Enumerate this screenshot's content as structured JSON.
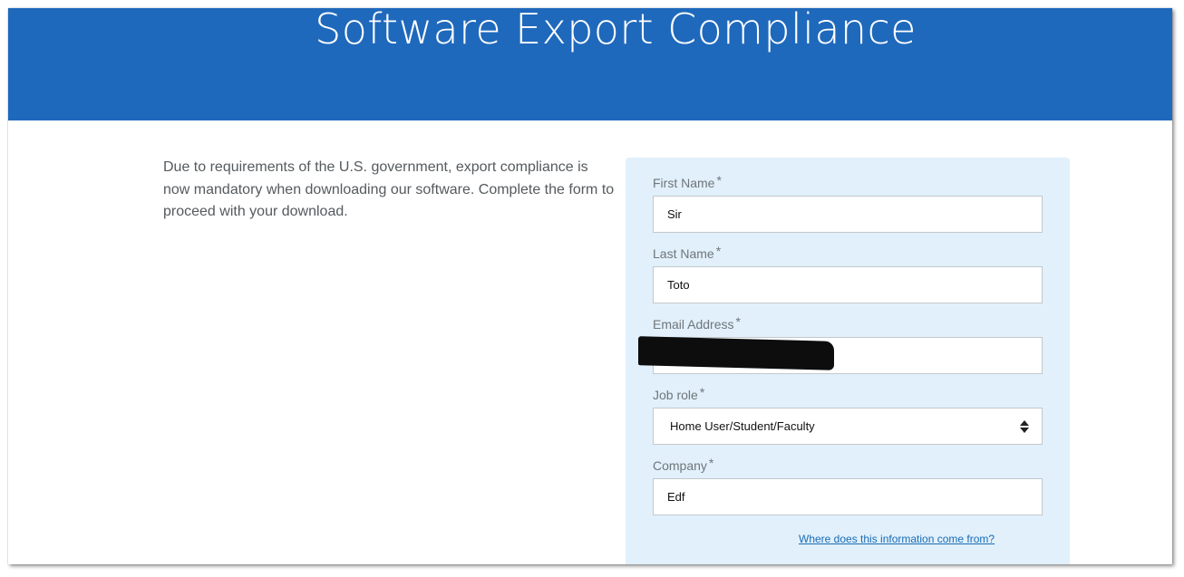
{
  "header": {
    "title": "Software Export Compliance"
  },
  "intro": {
    "text": "Due to requirements of the U.S. government, export compliance is now mandatory when downloading our software. Complete the form to proceed with your download."
  },
  "form": {
    "required_mark": "*",
    "first_name": {
      "label": "First Name",
      "value": "Sir"
    },
    "last_name": {
      "label": "Last Name",
      "value": "Toto"
    },
    "email": {
      "label": "Email Address",
      "value": "",
      "redacted": true
    },
    "job_role": {
      "label": "Job role",
      "selected": "Home User/Student/Faculty",
      "icon": "select-arrows-icon"
    },
    "company": {
      "label": "Company",
      "value": "Edf"
    },
    "help_link": "Where does this information come from?"
  },
  "colors": {
    "header_bg": "#1f69bc",
    "panel_bg": "#e1f0fb",
    "link": "#1a6cb5"
  }
}
